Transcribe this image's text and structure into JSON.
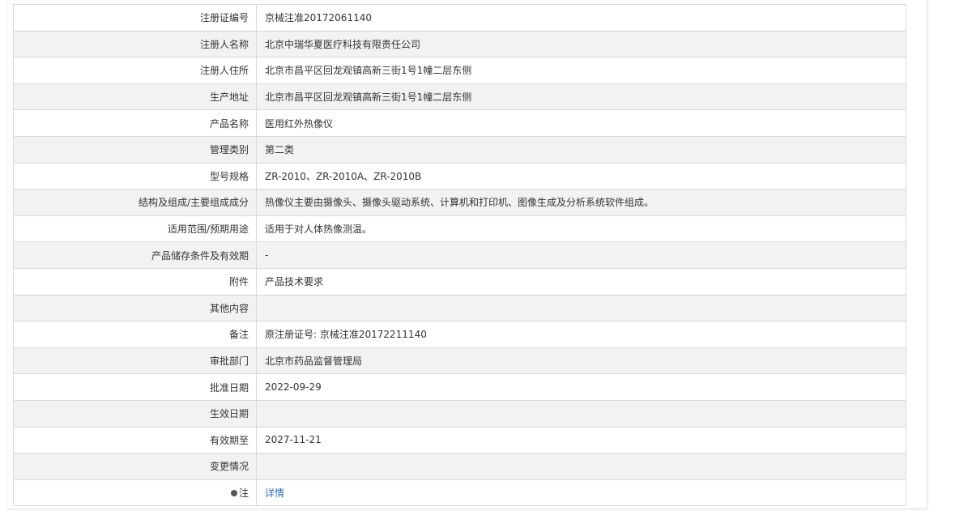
{
  "record": {
    "rows": [
      {
        "label": "注册证编号",
        "value": "京械注准20172061140"
      },
      {
        "label": "注册人名称",
        "value": "北京中瑞华夏医疗科技有限责任公司"
      },
      {
        "label": "注册人住所",
        "value": "北京市昌平区回龙观镇高新三街1号1幢二层东侧"
      },
      {
        "label": "生产地址",
        "value": "北京市昌平区回龙观镇高新三街1号1幢二层东侧"
      },
      {
        "label": "产品名称",
        "value": "医用红外热像仪"
      },
      {
        "label": "管理类别",
        "value": "第二类"
      },
      {
        "label": "型号规格",
        "value": "ZR-2010、ZR-2010A、ZR-2010B"
      },
      {
        "label": "结构及组成/主要组成成分",
        "value": "热像仪主要由摄像头、摄像头驱动系统、计算机和打印机、图像生成及分析系统软件组成。"
      },
      {
        "label": "适用范围/预期用途",
        "value": "适用于对人体热像测温。"
      },
      {
        "label": "产品储存条件及有效期",
        "value": "-"
      },
      {
        "label": "附件",
        "value": "产品技术要求"
      },
      {
        "label": "其他内容",
        "value": ""
      },
      {
        "label": "备注",
        "value": "原注册证号: 京械注准20172211140"
      },
      {
        "label": "审批部门",
        "value": "北京市药品监督管理局"
      },
      {
        "label": "批准日期",
        "value": "2022-09-29"
      },
      {
        "label": "生效日期",
        "value": ""
      },
      {
        "label": "有效期至",
        "value": "2027-11-21"
      },
      {
        "label": "变更情况",
        "value": ""
      },
      {
        "label": "注",
        "value": "详情",
        "icon": "note-dot-icon"
      }
    ]
  },
  "colors": {
    "row_alt_bg": "#f2f2f2",
    "border": "#d9d9d9",
    "link": "#2a6fb5",
    "text": "#333333"
  }
}
